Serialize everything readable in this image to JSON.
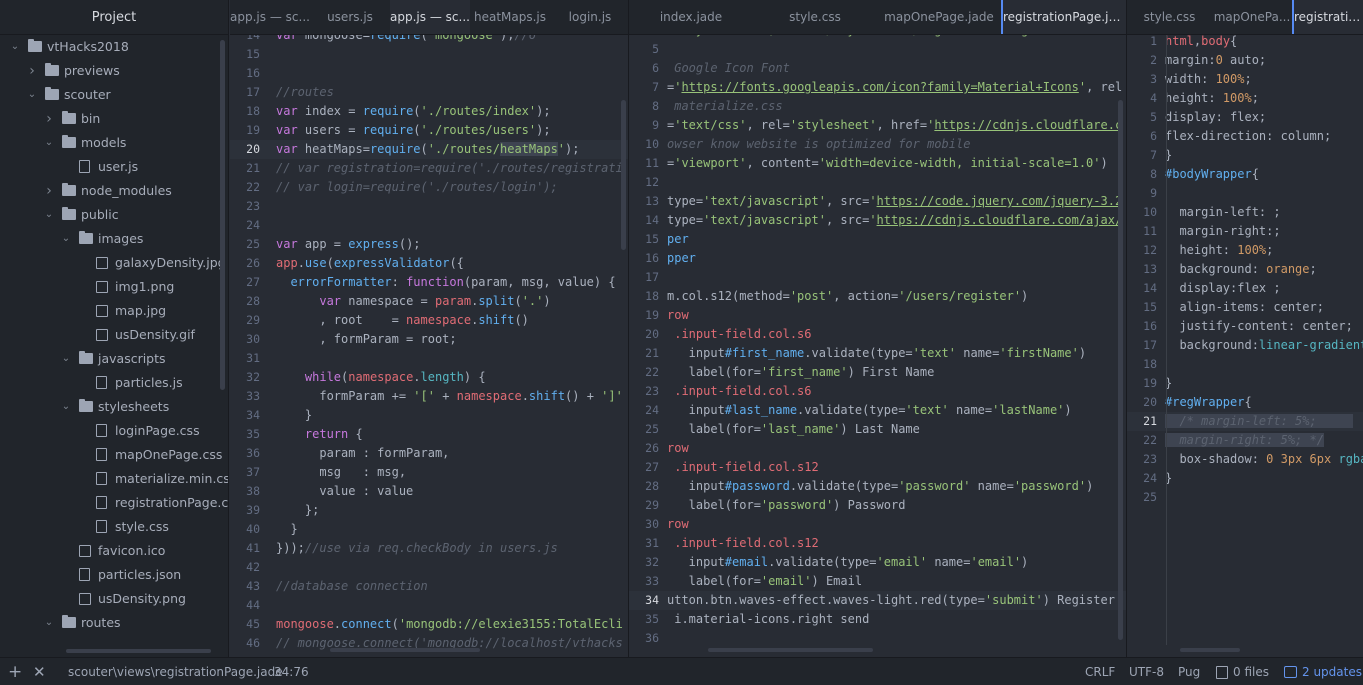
{
  "tree": {
    "header": "Project",
    "items": [
      {
        "label": "vtHacks2018",
        "type": "folder",
        "open": true,
        "depth": 0
      },
      {
        "label": "previews",
        "type": "folder",
        "open": false,
        "depth": 1
      },
      {
        "label": "scouter",
        "type": "folder",
        "open": true,
        "depth": 1
      },
      {
        "label": "bin",
        "type": "folder",
        "open": false,
        "depth": 2
      },
      {
        "label": "models",
        "type": "folder",
        "open": true,
        "depth": 2
      },
      {
        "label": "user.js",
        "type": "file",
        "depth": 3
      },
      {
        "label": "node_modules",
        "type": "folder",
        "open": false,
        "depth": 2
      },
      {
        "label": "public",
        "type": "folder",
        "open": true,
        "depth": 2
      },
      {
        "label": "images",
        "type": "folder",
        "open": true,
        "depth": 3
      },
      {
        "label": "galaxyDensity.jpg",
        "type": "image",
        "depth": 4
      },
      {
        "label": "img1.png",
        "type": "image",
        "depth": 4
      },
      {
        "label": "map.jpg",
        "type": "image",
        "depth": 4
      },
      {
        "label": "usDensity.gif",
        "type": "image",
        "depth": 4
      },
      {
        "label": "javascripts",
        "type": "folder",
        "open": true,
        "depth": 3
      },
      {
        "label": "particles.js",
        "type": "file",
        "depth": 4
      },
      {
        "label": "stylesheets",
        "type": "folder",
        "open": true,
        "depth": 3
      },
      {
        "label": "loginPage.css",
        "type": "file",
        "depth": 4
      },
      {
        "label": "mapOnePage.css",
        "type": "file",
        "depth": 4
      },
      {
        "label": "materialize.min.css",
        "type": "file",
        "depth": 4
      },
      {
        "label": "registrationPage.css",
        "type": "file",
        "depth": 4
      },
      {
        "label": "style.css",
        "type": "file",
        "depth": 4
      },
      {
        "label": "favicon.ico",
        "type": "image",
        "depth": 3
      },
      {
        "label": "particles.json",
        "type": "file",
        "depth": 3
      },
      {
        "label": "usDensity.png",
        "type": "image",
        "depth": 3
      },
      {
        "label": "routes",
        "type": "folder",
        "open": true,
        "depth": 2
      }
    ]
  },
  "tabs": {
    "pane1": [
      {
        "label": "app.js — sc...",
        "active": false
      },
      {
        "label": "users.js",
        "active": false
      },
      {
        "label": "app.js — sc...",
        "active": true
      },
      {
        "label": "heatMaps.js",
        "active": false
      },
      {
        "label": "login.js",
        "active": false
      }
    ],
    "pane2": [
      {
        "label": "index.jade",
        "active": false
      },
      {
        "label": "style.css",
        "active": false
      },
      {
        "label": "mapOnePage.jade",
        "active": false
      },
      {
        "label": "registrationPage.ja...",
        "active": true
      }
    ],
    "pane3": [
      {
        "label": "style.css",
        "active": false
      },
      {
        "label": "mapOnePa...",
        "active": false
      },
      {
        "label": "registration",
        "active": true
      }
    ]
  },
  "pane1": {
    "lines": [
      {
        "n": "14",
        "html": "<span class='kw'>var</span> mongoose=<span class='fn'>require</span>(<span class='str'>'mongoose'</span>);<span class='cm'>//6</span>"
      },
      {
        "n": "15",
        "html": ""
      },
      {
        "n": "16",
        "html": ""
      },
      {
        "n": "17",
        "html": "<span class='cm'>//routes</span>"
      },
      {
        "n": "18",
        "html": "<span class='kw'>var</span> index = <span class='fn'>require</span>(<span class='str'>'./routes/index'</span>);"
      },
      {
        "n": "19",
        "html": "<span class='kw'>var</span> users = <span class='fn'>require</span>(<span class='str'>'./routes/users'</span>);"
      },
      {
        "n": "20",
        "html": "<span class='kw'>var</span> heatMaps=<span class='fn'>require</span>(<span class='str'>'./routes/<span class=\"hl-sel\">heatMaps</span>'</span>);",
        "cur": true
      },
      {
        "n": "21",
        "html": "<span class='cm'>// var registration=require('./routes/registrati</span>"
      },
      {
        "n": "22",
        "html": "<span class='cm'>// var login=require('./routes/login');</span>"
      },
      {
        "n": "23",
        "html": ""
      },
      {
        "n": "24",
        "html": ""
      },
      {
        "n": "25",
        "html": "<span class='kw'>var</span> app = <span class='fn'>express</span>();"
      },
      {
        "n": "26",
        "html": "<span class='var'>app</span>.<span class='fn'>use</span>(<span class='fn'>expressValidator</span>({"
      },
      {
        "n": "27",
        "html": "  <span class='fn'>errorFormatter</span>: <span class='kw'>function</span>(param, msg, value) {"
      },
      {
        "n": "28",
        "html": "      <span class='kw'>var</span> namespace = <span class='var'>param</span>.<span class='fn'>split</span>(<span class='str'>'.'</span>)"
      },
      {
        "n": "29",
        "html": "      , root    = <span class='var'>namespace</span>.<span class='fn'>shift</span>()"
      },
      {
        "n": "30",
        "html": "      , formParam = root;"
      },
      {
        "n": "31",
        "html": ""
      },
      {
        "n": "32",
        "html": "    <span class='kw'>while</span>(<span class='var'>namespace</span>.<span class='prop'>length</span>) {"
      },
      {
        "n": "33",
        "html": "      formParam += <span class='str'>'['</span> + <span class='var'>namespace</span>.<span class='fn'>shift</span>() + <span class='str'>']'</span>"
      },
      {
        "n": "34",
        "html": "    }"
      },
      {
        "n": "35",
        "html": "    <span class='kw'>return</span> {"
      },
      {
        "n": "36",
        "html": "      param : formParam,"
      },
      {
        "n": "37",
        "html": "      msg   : msg,"
      },
      {
        "n": "38",
        "html": "      value : value"
      },
      {
        "n": "39",
        "html": "    };"
      },
      {
        "n": "40",
        "html": "  }"
      },
      {
        "n": "41",
        "html": "}));<span class='cm'>//use via req.checkBody in users.js</span>"
      },
      {
        "n": "42",
        "html": ""
      },
      {
        "n": "43",
        "html": "<span class='cm'>//database connection</span>"
      },
      {
        "n": "44",
        "html": ""
      },
      {
        "n": "45",
        "html": "<span class='var'>mongoose</span>.<span class='fn'>connect</span>(<span class='str'>'mongodb://elexie3155:TotalEcli</span>"
      },
      {
        "n": "46",
        "html": "<span class='cm'>// mongoose.connect('mongodb://localhost/vthacks</span>"
      }
    ]
  },
  "pane2": {
    "lines": [
      {
        "n": "",
        "html": "<span class='str'>  stylesheets', href='/stylesheets/registrationPage.css'</span>"
      },
      {
        "n": "5",
        "html": ""
      },
      {
        "n": "6",
        "html": " <span class='cm'>Google Icon Font</span>"
      },
      {
        "n": "7",
        "html": "=<span class='str'>'</span><span class='url'>https://fonts.googleapis.com/icon?family=Material+Icons</span><span class='str'>'</span>, rel"
      },
      {
        "n": "8",
        "html": " <span class='cm'>materialize.css</span>"
      },
      {
        "n": "9",
        "html": "=<span class='str'>'text/css'</span>, rel=<span class='str'>'stylesheet'</span>, href=<span class='str'>'</span><span class='url'>https://cdnjs.cloudflare.c</span>"
      },
      {
        "n": "10",
        "html": "<span class='cm'>owser know website is optimized for mobile</span>"
      },
      {
        "n": "11",
        "html": "=<span class='str'>'viewport'</span>, content=<span class='str'>'width=device-width, initial-scale=1.0'</span>)"
      },
      {
        "n": "12",
        "html": ""
      },
      {
        "n": "13",
        "html": "type=<span class='str'>'text/javascript'</span>, src=<span class='str'>'</span><span class='url'>https://code.jquery.com/jquery-3.2</span>"
      },
      {
        "n": "14",
        "html": "type=<span class='str'>'text/javascript'</span>, src=<span class='str'>'</span><span class='url'>https://cdnjs.cloudflare.com/ajax/</span>"
      },
      {
        "n": "15",
        "html": "<span class='id'>per</span>"
      },
      {
        "n": "16",
        "html": "<span class='id'>pper</span>"
      },
      {
        "n": "17",
        "html": ""
      },
      {
        "n": "18",
        "html": "m.col.s12(method=<span class='str'>'post'</span>, action=<span class='str'>'/users/register'</span>)"
      },
      {
        "n": "19",
        "html": "<span class='tag'>row</span>"
      },
      {
        "n": "20",
        "html": " <span class='sel'>.input-field.col.s6</span>"
      },
      {
        "n": "21",
        "html": "   input<span class='id'>#first_name</span>.validate(type=<span class='str'>'text'</span> name=<span class='str'>'firstName'</span>)"
      },
      {
        "n": "22",
        "html": "   label(for=<span class='str'>'first_name'</span>) First Name"
      },
      {
        "n": "23",
        "html": " <span class='sel'>.input-field.col.s6</span>"
      },
      {
        "n": "24",
        "html": "   input<span class='id'>#last_name</span>.validate(type=<span class='str'>'text'</span> name=<span class='str'>'lastName'</span>)"
      },
      {
        "n": "25",
        "html": "   label(for=<span class='str'>'last_name'</span>) Last Name"
      },
      {
        "n": "26",
        "html": "<span class='tag'>row</span>"
      },
      {
        "n": "27",
        "html": " <span class='sel'>.input-field.col.s12</span>"
      },
      {
        "n": "28",
        "html": "   input<span class='id'>#password</span>.validate(type=<span class='str'>'password'</span> name=<span class='str'>'password'</span>)"
      },
      {
        "n": "29",
        "html": "   label(for=<span class='str'>'password'</span>) Password"
      },
      {
        "n": "30",
        "html": "<span class='tag'>row</span>"
      },
      {
        "n": "31",
        "html": " <span class='sel'>.input-field.col.s12</span>"
      },
      {
        "n": "32",
        "html": "   input<span class='id'>#email</span>.validate(type=<span class='str'>'email'</span> name=<span class='str'>'email'</span>)"
      },
      {
        "n": "33",
        "html": "   label(for=<span class='str'>'email'</span>) Email"
      },
      {
        "n": "34",
        "html": "utton.btn.waves-effect.waves-light.red(type=<span class='str'>'submit'</span>) Register",
        "cur": true
      },
      {
        "n": "35",
        "html": " i.material-icons.right send"
      },
      {
        "n": "36",
        "html": ""
      }
    ]
  },
  "pane3": {
    "lines": [
      {
        "n": "1",
        "html": "<span class='sel'>html</span>,<span class='sel'>body</span>{"
      },
      {
        "n": "2",
        "html": "margin:<span class='num'>0</span> auto;"
      },
      {
        "n": "3",
        "html": "width: <span class='num'>100%</span>;"
      },
      {
        "n": "4",
        "html": "height: <span class='num'>100%</span>;"
      },
      {
        "n": "5",
        "html": "display: flex;"
      },
      {
        "n": "6",
        "html": "flex-direction: column;"
      },
      {
        "n": "7",
        "html": "}"
      },
      {
        "n": "8",
        "html": "<span class='id'>#bodyWrapper</span>{"
      },
      {
        "n": "9",
        "html": ""
      },
      {
        "n": "10",
        "html": "  margin-left: ;"
      },
      {
        "n": "11",
        "html": "  margin-right:;"
      },
      {
        "n": "12",
        "html": "  height: <span class='num'>100%</span>;"
      },
      {
        "n": "13",
        "html": "  background: <span class='num'>orange</span>;"
      },
      {
        "n": "14",
        "html": "  display:flex ;"
      },
      {
        "n": "15",
        "html": "  align-items: center;"
      },
      {
        "n": "16",
        "html": "  justify-content: center;"
      },
      {
        "n": "17",
        "html": "  background:<span class='prop'>linear-gradient</span>"
      },
      {
        "n": "18",
        "html": ""
      },
      {
        "n": "19",
        "html": "}"
      },
      {
        "n": "20",
        "html": "<span class='id'>#regWrapper</span>{"
      },
      {
        "n": "21",
        "html": "<span class='hl-sel'>  <span class='cm'>/* margin-left: 5%;</span>     </span>",
        "cur": true
      },
      {
        "n": "22",
        "html": "<span class='hl-sel'>  <span class='cm'>margin-right: 5%; */</span></span>"
      },
      {
        "n": "23",
        "html": "  box-shadow: <span class='num'>0</span> <span class='num'>3px</span> <span class='num'>6px</span> <span class='prop'>rgba</span>"
      },
      {
        "n": "24",
        "html": "}"
      },
      {
        "n": "25",
        "html": ""
      }
    ]
  },
  "status": {
    "path": "scouter\\views\\registrationPage.jade",
    "cursor": "34:76",
    "line_ending": "CRLF",
    "encoding": "UTF-8",
    "grammar": "Pug",
    "files": "0 files",
    "updates": "2 updates"
  }
}
